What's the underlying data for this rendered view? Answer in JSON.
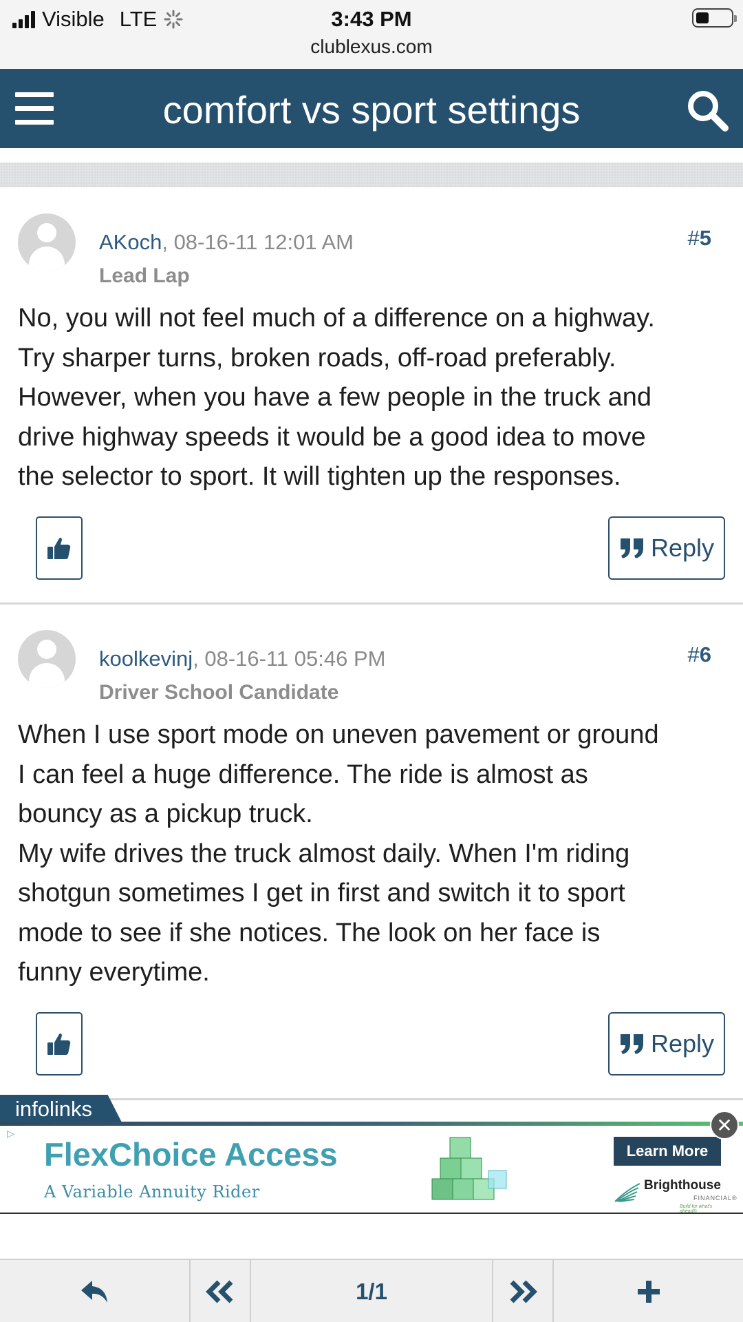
{
  "status_bar": {
    "carrier": "Visible",
    "network": "LTE",
    "time": "3:43 PM",
    "url": "clublexus.com"
  },
  "header": {
    "title": "comfort vs sport settings",
    "menu_icon": "hamburger-menu-icon",
    "search_icon": "search-icon"
  },
  "posts": [
    {
      "username": "AKoch",
      "date": ", 08-16-11 12:01 AM",
      "rank": "Lead Lap",
      "number_prefix": "#",
      "number": "5",
      "lines": [
        "No, you will not feel much of a difference on a highway.",
        "Try sharper turns, broken roads, off-road preferably.",
        "However, when you have a few people in the truck and",
        "drive highway speeds it would be a good idea to move",
        "the selector to sport. It will tighten up the responses."
      ],
      "reply_label": "Reply"
    },
    {
      "username": "koolkevinj",
      "date": ", 08-16-11 05:46 PM",
      "rank": "Driver School Candidate",
      "number_prefix": "#",
      "number": "6",
      "lines": [
        "When I use sport mode on uneven pavement or ground",
        "I can feel a huge difference. The ride is almost as",
        "bouncy as a pickup truck.",
        "My wife drives the truck almost daily. When I'm riding",
        "shotgun sometimes I get in first and switch it to sport",
        "mode to see if she notices. The look on her face is",
        "funny everytime."
      ],
      "reply_label": "Reply"
    }
  ],
  "ad": {
    "network_label": "infolinks",
    "headline": "FlexChoice Access",
    "subline": "A Variable Annuity Rider",
    "cta": "Learn More",
    "brand": "Brighthouse",
    "brand_sub": "FINANCIAL®",
    "brand_tagline": "Build for what's ahead®",
    "close_label": "✕"
  },
  "toolbar": {
    "page_indicator": "1/1",
    "icons": [
      "reply-back-icon",
      "double-left-icon",
      "double-right-icon",
      "plus-icon"
    ]
  },
  "colors": {
    "header_bg": "#25506e",
    "link": "#2e5a80",
    "ad_headline": "#3fa0b2"
  }
}
